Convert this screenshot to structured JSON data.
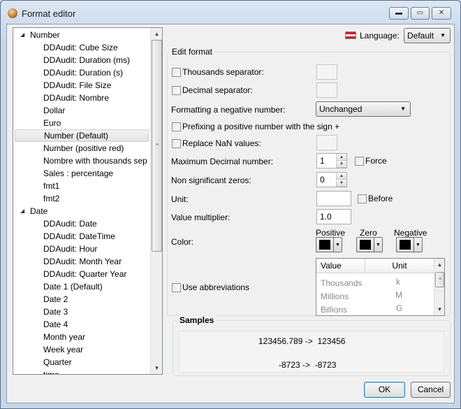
{
  "window": {
    "title": "Format editor"
  },
  "tree": {
    "items": [
      {
        "label": "Number",
        "level": 0,
        "expanded": true
      },
      {
        "label": "DDAudit: Cube Size",
        "level": 1
      },
      {
        "label": "DDAudit: Duration (ms)",
        "level": 1
      },
      {
        "label": "DDAudit: Duration (s)",
        "level": 1
      },
      {
        "label": "DDAudit: File Size",
        "level": 1
      },
      {
        "label": "DDAudit: Nombre",
        "level": 1
      },
      {
        "label": "Dollar",
        "level": 1
      },
      {
        "label": "Euro",
        "level": 1
      },
      {
        "label": "Number (Default)",
        "level": 1,
        "selected": true
      },
      {
        "label": "Number (positive red)",
        "level": 1
      },
      {
        "label": "Nombre with thousands sep",
        "level": 1
      },
      {
        "label": "Sales : percentage",
        "level": 1
      },
      {
        "label": "fmt1",
        "level": 1
      },
      {
        "label": "fmt2",
        "level": 1
      },
      {
        "label": "Date",
        "level": 0,
        "expanded": true
      },
      {
        "label": "DDAudit: Date",
        "level": 1
      },
      {
        "label": "DDAudit: DateTime",
        "level": 1
      },
      {
        "label": "DDAudit: Hour",
        "level": 1
      },
      {
        "label": "DDAudit: Month Year",
        "level": 1
      },
      {
        "label": "DDAudit: Quarter Year",
        "level": 1
      },
      {
        "label": "Date 1 (Default)",
        "level": 1
      },
      {
        "label": "Date 2",
        "level": 1
      },
      {
        "label": "Date 3",
        "level": 1
      },
      {
        "label": "Date 4",
        "level": 1
      },
      {
        "label": "Month year",
        "level": 1
      },
      {
        "label": "Week year",
        "level": 1
      },
      {
        "label": "Quarter",
        "level": 1
      },
      {
        "label": "time",
        "level": 1
      }
    ]
  },
  "language": {
    "label": "Language:",
    "value": "Default"
  },
  "edit_format": {
    "title": "Edit format",
    "thousands_separator": "Thousands separator:",
    "decimal_separator": "Decimal separator:",
    "negative_label": "Formatting a negative number:",
    "negative_value": "Unchanged",
    "prefix_positive": "Prefixing a positive number with the sign +",
    "replace_nan": "Replace NaN values:",
    "max_decimal_label": "Maximum Decimal number:",
    "max_decimal_value": "1",
    "force": "Force",
    "non_significant_label": "Non significant zeros:",
    "non_significant_value": "0",
    "unit_label": "Unit:",
    "unit_value": "",
    "before": "Before",
    "multiplier_label": "Value multiplier:",
    "multiplier_value": "1.0",
    "color_label": "Color:",
    "color_positive": "Positive",
    "color_zero": "Zero",
    "color_negative": "Negative",
    "swatch_color": "#000000",
    "use_abbreviations": "Use abbreviations"
  },
  "abbreviations": {
    "headers": {
      "value": "Value",
      "unit": "Unit"
    },
    "rows": [
      {
        "value": "Thousands",
        "unit": "k"
      },
      {
        "value": "Millions",
        "unit": "M"
      },
      {
        "value": "Billions",
        "unit": "G"
      }
    ]
  },
  "samples": {
    "title": "Samples",
    "lines": [
      {
        "input": "123456.789",
        "arrow": "->",
        "output": "123456"
      },
      {
        "input": "-8723",
        "arrow": "->",
        "output": "-8723"
      }
    ]
  },
  "buttons": {
    "ok": "OK",
    "cancel": "Cancel"
  }
}
